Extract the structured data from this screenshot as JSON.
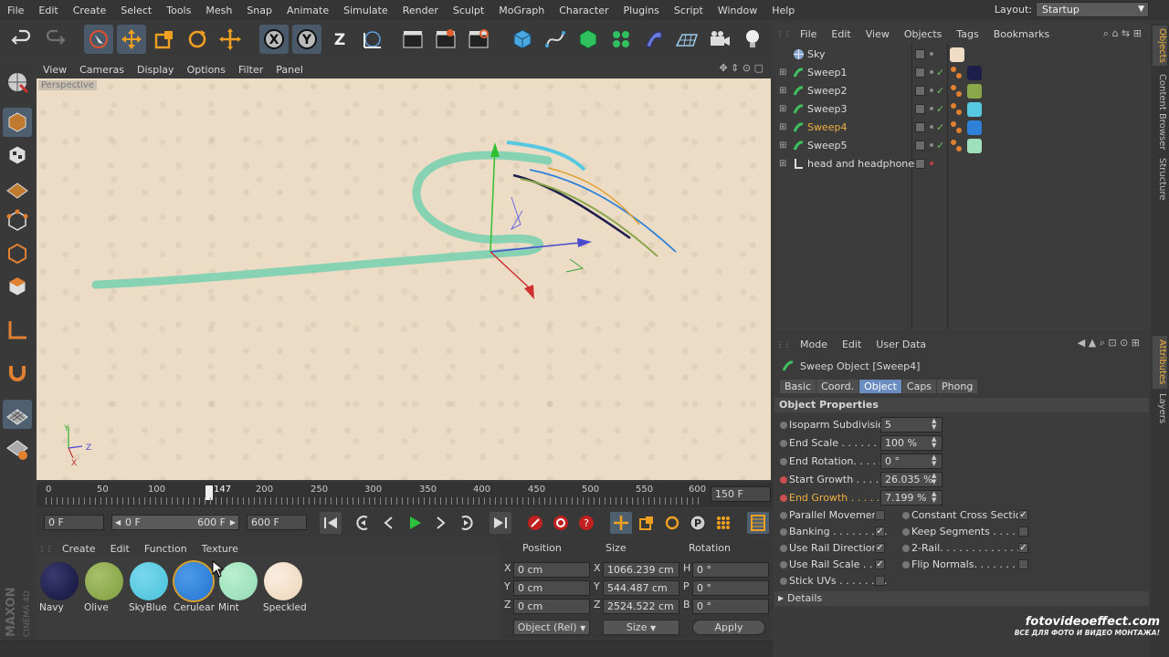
{
  "menubar": {
    "items": [
      "File",
      "Edit",
      "Create",
      "Select",
      "Tools",
      "Mesh",
      "Snap",
      "Animate",
      "Simulate",
      "Render",
      "Sculpt",
      "MoGraph",
      "Character",
      "Plugins",
      "Script",
      "Window",
      "Help"
    ],
    "layout_label": "Layout:",
    "layout_value": "Startup"
  },
  "toolbar": {
    "icons": [
      "undo-icon",
      "redo-icon",
      "live-selection-icon",
      "move-icon",
      "scale-icon",
      "rotate-icon",
      "move-alt-icon",
      "x-axis-icon",
      "y-axis-icon",
      "z-axis-icon",
      "world-coordinates-icon",
      "render-view-icon",
      "render-picture-viewer-icon",
      "edit-render-settings-icon",
      "cube-icon",
      "pen-spline-icon",
      "subdivision-icon",
      "cloner-icon",
      "deformer-icon",
      "floor-icon",
      "camera-icon",
      "light-icon"
    ],
    "x_label": "X",
    "y_label": "Y",
    "z_label": "Z"
  },
  "viewport": {
    "menu": [
      "View",
      "Cameras",
      "Display",
      "Options",
      "Filter",
      "Panel"
    ],
    "label": "Perspective",
    "axis_y": "Y",
    "axis_z": "Z",
    "axis_x": "X"
  },
  "timeline": {
    "ticks": [
      "0",
      "50",
      "100",
      "147",
      "200",
      "250",
      "300",
      "350",
      "400",
      "450",
      "500",
      "550",
      "600"
    ],
    "current_frame": 147,
    "end_field": "150 F"
  },
  "transport": {
    "start": "0 F",
    "range_start": "0 F",
    "range_end": "600 F",
    "end": "600 F"
  },
  "materials": {
    "menu": [
      "Create",
      "Edit",
      "Function",
      "Texture"
    ],
    "items": [
      {
        "name": "Navy",
        "color": "#1e1e4a"
      },
      {
        "name": "Olive",
        "color": "#8aa84a"
      },
      {
        "name": "SkyBlue",
        "color": "#56c8e0"
      },
      {
        "name": "Cerulear",
        "color": "#2e80d8"
      },
      {
        "name": "Mint",
        "color": "#9ee0bc"
      },
      {
        "name": "Speckled",
        "color": "#f0dcc4"
      }
    ],
    "selected": "Cerulear"
  },
  "coords": {
    "headers": [
      "Position",
      "Size",
      "Rotation"
    ],
    "rows": [
      {
        "pa": "X",
        "pv": "0 cm",
        "sa": "X",
        "sv": "1066.239 cm",
        "ra": "H",
        "rv": "0 °"
      },
      {
        "pa": "Y",
        "pv": "0 cm",
        "sa": "Y",
        "sv": "544.487 cm",
        "ra": "P",
        "rv": "0 °"
      },
      {
        "pa": "Z",
        "pv": "0 cm",
        "sa": "Z",
        "sv": "2524.522 cm",
        "ra": "B",
        "rv": "0 °"
      }
    ],
    "mode": "Object (Rel)",
    "size_mode": "Size",
    "apply": "Apply"
  },
  "brand": {
    "maxon": "MAXON",
    "cinema": "CINEMA 4D"
  },
  "objects": {
    "menu": [
      "File",
      "Edit",
      "View",
      "Objects",
      "Tags",
      "Bookmarks"
    ],
    "items": [
      {
        "name": "Sky",
        "swatch": "#f0dcc4",
        "check": ""
      },
      {
        "name": "Sweep1",
        "swatch": "#1e1e4a",
        "check": "✓"
      },
      {
        "name": "Sweep2",
        "swatch": "#8aa84a",
        "check": "✓"
      },
      {
        "name": "Sweep3",
        "swatch": "#56c8e0",
        "check": "✓"
      },
      {
        "name": "Sweep4",
        "swatch": "#2e80d8",
        "check": "✓"
      },
      {
        "name": "Sweep5",
        "swatch": "#9ee0bc",
        "check": "✓"
      },
      {
        "name": "head and headphones",
        "swatch": "",
        "check": ""
      }
    ],
    "active": "Sweep4"
  },
  "side_tabs": [
    "Objects",
    "Content Browser",
    "Structure",
    "Attributes",
    "Layers"
  ],
  "attributes": {
    "menu": [
      "Mode",
      "Edit",
      "User Data"
    ],
    "title": "Sweep Object [Sweep4]",
    "tabs": [
      "Basic",
      "Coord.",
      "Object",
      "Caps",
      "Phong"
    ],
    "active_tab": "Object",
    "section": "Object Properties",
    "props": [
      {
        "label": "Isoparm Subdivision",
        "value": "5"
      },
      {
        "label": "End Scale . . . . . . . . .",
        "value": "100 %"
      },
      {
        "label": "End Rotation. . . . . . .",
        "value": "0 °"
      },
      {
        "label": "Start Growth . . . . . . .",
        "value": "26.035 %"
      },
      {
        "label": "End Growth . . . . . . .",
        "value": "7.199 %"
      }
    ],
    "checks_left": [
      {
        "label": "Parallel Movement",
        "checked": ""
      },
      {
        "label": "Banking . . . . . . . . .",
        "checked": "✓"
      },
      {
        "label": "Use Rail Direction",
        "checked": "✓"
      },
      {
        "label": "Use Rail Scale . . . .",
        "checked": "✓"
      },
      {
        "label": "Stick UVs . . . . . . . .",
        "checked": ""
      }
    ],
    "checks_right": [
      {
        "label": "Constant Cross Section",
        "checked": "✓"
      },
      {
        "label": "Keep Segments . . . . .",
        "checked": ""
      },
      {
        "label": "2-Rail. . . . . . . . . . . . .",
        "checked": "✓"
      },
      {
        "label": "Flip Normals. . . . . . .",
        "checked": ""
      }
    ],
    "details": "Details"
  },
  "watermark": {
    "line1": "fotovideoeffect.com",
    "line2": "ВСЕ ДЛЯ ФОТО И ВИДЕО МОНТАЖА!"
  }
}
